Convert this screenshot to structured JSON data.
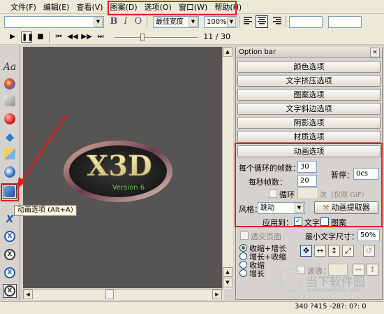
{
  "menubar": {
    "items": [
      "文件(F)",
      "编辑(E)",
      "查看(V)",
      "图案(D)",
      "选项(O)",
      "窗口(W)",
      "帮助(H)"
    ]
  },
  "toolbar": {
    "font_combo": "",
    "bold": "B",
    "italic": "I",
    "outline": "O",
    "width_combo": "最佳宽度",
    "zoom_combo": "100%"
  },
  "player": {
    "frame_counter": "11 / 30",
    "slider_position": 0.33
  },
  "canvas": {
    "logo_text": "X3D",
    "logo_subtext": "Version 6"
  },
  "tooltip": {
    "text": "动画选项 (Alt+A)"
  },
  "option_bar": {
    "title": "Option bar",
    "close": "×",
    "sections": [
      "颜色选项",
      "文字挤压选项",
      "图案选项",
      "文字斜边选项",
      "阴影选项",
      "材质选项",
      "动画选项"
    ],
    "animation": {
      "frames_per_loop_label": "每个循环的帧数：",
      "frames_per_loop_value": "30",
      "fps_label": "每秒帧数：",
      "fps_value": "20",
      "pause_label": "暂停：",
      "pause_value": "0cs",
      "loop_label": "循环",
      "loop_count_suffix": "次（仅限 GIF）",
      "style_label": "风格：",
      "style_value": "跳动",
      "extractor_button": "动画提取器",
      "apply_to_label": "应用到：",
      "apply_text_label": "文字",
      "apply_pattern_label": "图案"
    },
    "transparent_page_label": "透交页面",
    "min_text_size_label": "最小文字尺寸：",
    "min_text_size_value": "50%",
    "radio_options": [
      "收缩+增长",
      "增长+收缩",
      "收缩",
      "增长"
    ],
    "wave_label": "波浪："
  },
  "status": {
    "text": "340 ?415  -28?: 0?: 0"
  },
  "watermark": {
    "text": "当下软件园",
    "url": "www.downxia.com"
  }
}
